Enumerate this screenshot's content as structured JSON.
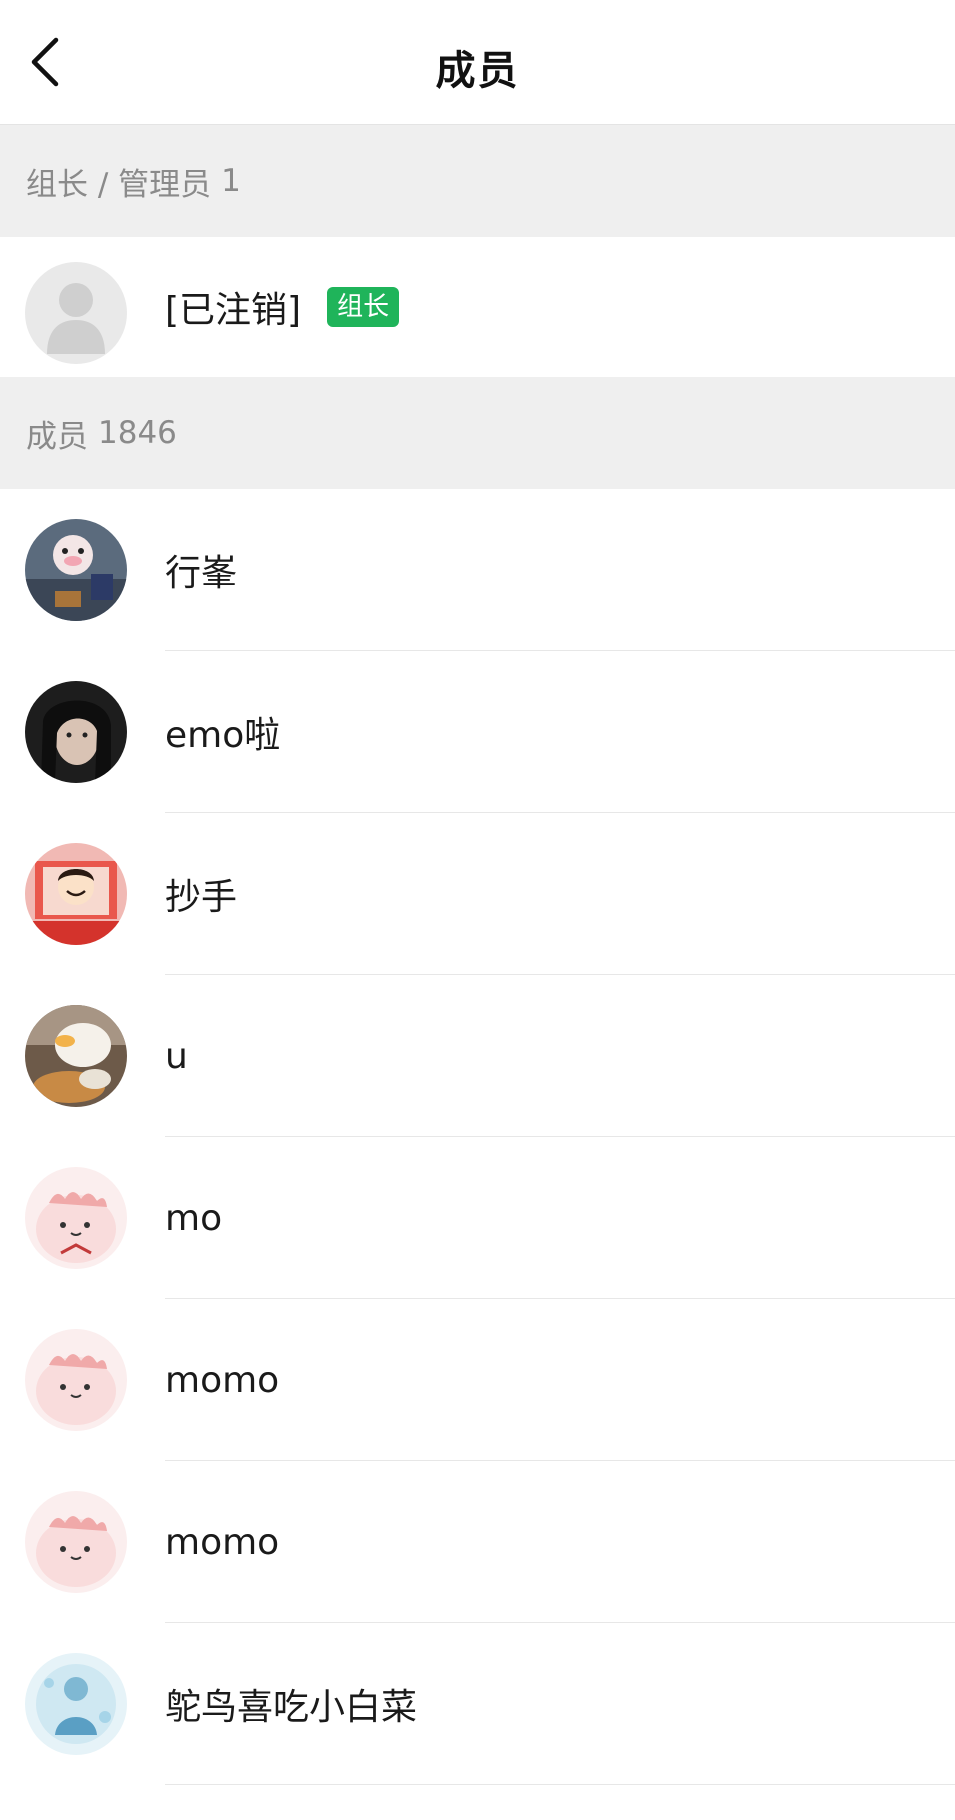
{
  "header": {
    "title": "成员"
  },
  "admins_section": {
    "label": "组长 / 管理员",
    "count": "1"
  },
  "owner": {
    "name": "[已注销]",
    "badge": "组长"
  },
  "members_section": {
    "label": "成员",
    "count": "1846"
  },
  "members": [
    {
      "name": "行峯"
    },
    {
      "name": "emo啦"
    },
    {
      "name": "抄手"
    },
    {
      "name": "u"
    },
    {
      "name": "mo"
    },
    {
      "name": "momo"
    },
    {
      "name": "momo"
    },
    {
      "name": "鸵鸟喜吃小白菜"
    }
  ],
  "colors": {
    "badge_green": "#1fb45a",
    "section_bg": "#efefef",
    "section_text": "#8a8a8a"
  }
}
